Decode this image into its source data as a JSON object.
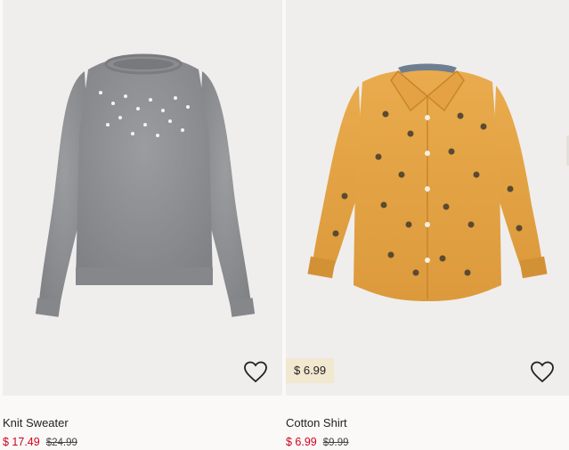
{
  "products": [
    {
      "name": "Knit Sweater",
      "sale_price": "$ 17.49",
      "original_price": "$24.99",
      "badge": null,
      "favorite_icon": "heart-outline-icon",
      "colors": {
        "sale": "#d0021b",
        "garment": "#8f9194"
      }
    },
    {
      "name": "Cotton Shirt",
      "sale_price": "$ 6.99",
      "original_price": "$9.99",
      "badge": "$ 6.99",
      "favorite_icon": "heart-outline-icon",
      "colors": {
        "sale": "#d0021b",
        "garment": "#e5a548",
        "badge_bg": "#f2e8d0"
      }
    }
  ]
}
